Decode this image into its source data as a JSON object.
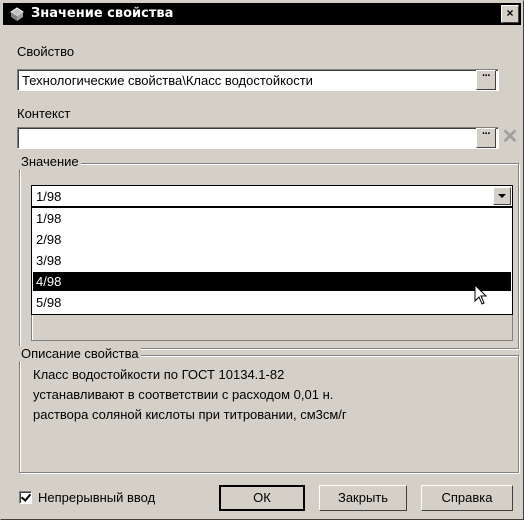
{
  "title": "Значение свойства",
  "close_label": "×",
  "property": {
    "label": "Свойство",
    "value": "Технологические свойства\\Класс водостойкости",
    "button": "···"
  },
  "context": {
    "label": "Контекст",
    "value": "",
    "button": "···",
    "delete_icon": "✕"
  },
  "value_group": {
    "title": "Значение",
    "selected": "1/98",
    "options": [
      "1/98",
      "2/98",
      "3/98",
      "4/98",
      "5/98"
    ],
    "highlighted": "4/98"
  },
  "description": {
    "title": "Описание свойства",
    "lines": [
      "Класс водостойкости по ГОСТ 10134.1-82",
      "устанавливают в соответствии с расходом 0,01 н.",
      "раствора соляной кислоты при титровании, см3см/г"
    ]
  },
  "continuous_input": {
    "label": "Непрерывный ввод",
    "checked": true
  },
  "buttons": {
    "ok": {
      "u": "О",
      "rest": "К"
    },
    "close": {
      "u": "З",
      "rest": "акрыть"
    },
    "help": {
      "u": "С",
      "rest": "правка"
    }
  },
  "colors": {
    "face": "#d4d0c8",
    "title_bg": "#000000",
    "selection": "#000000"
  }
}
